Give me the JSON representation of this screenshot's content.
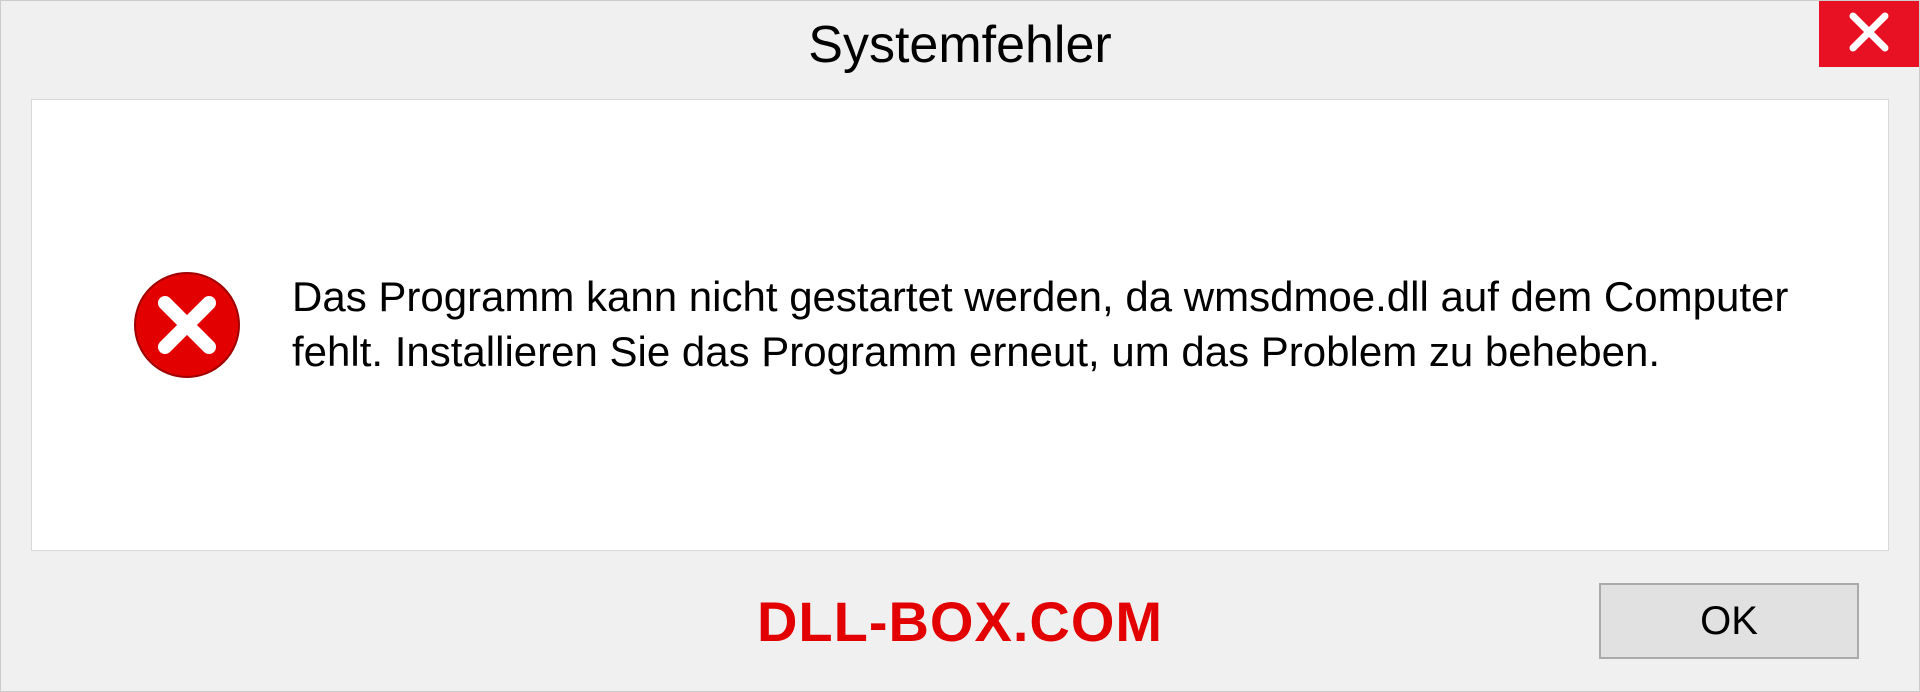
{
  "dialog": {
    "title": "Systemfehler",
    "message": "Das Programm kann nicht gestartet werden, da wmsdmoe.dll auf dem Computer fehlt. Installieren Sie das Programm erneut, um das Problem zu beheben.",
    "ok_label": "OK",
    "watermark": "DLL-BOX.COM"
  }
}
